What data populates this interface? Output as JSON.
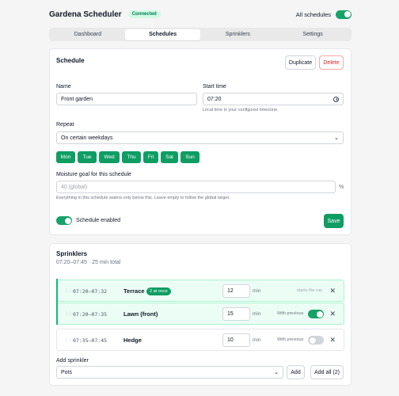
{
  "header": {
    "app_title": "Gardena Scheduler",
    "status_badge": "Connected",
    "all_schedules_label": "All schedules",
    "all_schedules_on": true
  },
  "tabs": [
    {
      "label": "Dashboard",
      "active": false
    },
    {
      "label": "Schedules",
      "active": true
    },
    {
      "label": "Sprinklers",
      "active": false
    },
    {
      "label": "Settings",
      "active": false
    }
  ],
  "schedule": {
    "title": "Schedule",
    "duplicate_label": "Duplicate",
    "delete_label": "Delete",
    "name_label": "Name",
    "name_value": "Front garden",
    "start_label": "Start time",
    "start_value": "07:20",
    "start_hint": "Local time in your configured timezone.",
    "repeat_label": "Repeat",
    "repeat_value": "On certain weekdays",
    "days": [
      "Mon",
      "Tue",
      "Wed",
      "Thu",
      "Fri",
      "Sat",
      "Sun"
    ],
    "moisture_label": "Moisture goal for this schedule",
    "moisture_placeholder": "40 (global)",
    "moisture_suffix": "%",
    "moisture_hint": "Everything in this schedule waters only below this. Leave empty to follow the global target.",
    "enabled_label": "Schedule enabled",
    "enabled_on": true,
    "save_label": "Save"
  },
  "sprinklers": {
    "title": "Sprinklers",
    "subtitle": "07:20–07:45 · 25 min total",
    "rows": [
      {
        "time": "07:20–07:32",
        "name": "Terrace",
        "pill": "2 at once",
        "minutes": "12",
        "min_label": "min",
        "note": "starts the run"
      },
      {
        "time": "07:20–07:35",
        "name": "Lawn (front)",
        "minutes": "15",
        "min_label": "min",
        "note": "With previous",
        "toggle_on": true
      },
      {
        "time": "07:35–07:45",
        "name": "Hedge",
        "minutes": "10",
        "min_label": "min",
        "note": "With previous",
        "toggle_on": false
      }
    ],
    "add_label": "Add sprinkler",
    "add_select_value": "Pots",
    "add_button": "Add",
    "add_all_button": "Add all (2)"
  },
  "colors": {
    "accent": "#0f9d63",
    "danger": "#dc2626"
  }
}
